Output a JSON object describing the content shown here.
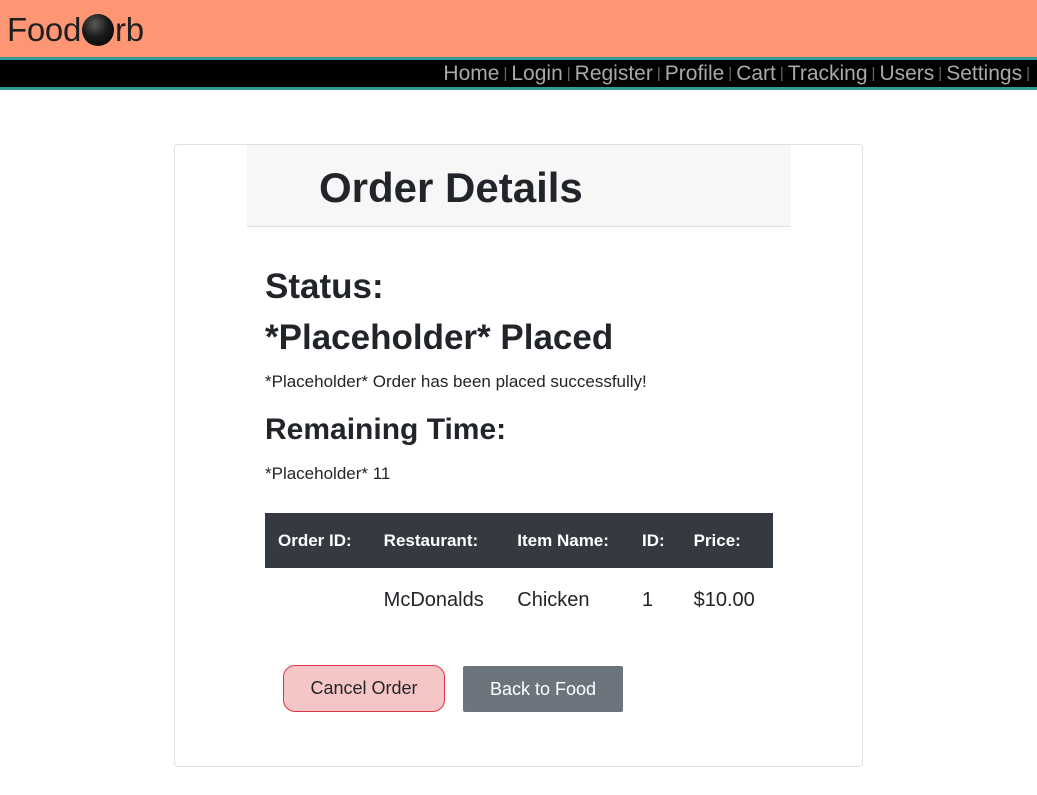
{
  "brand": {
    "prefix": "Food",
    "suffix": "rb"
  },
  "nav": {
    "items": [
      "Home",
      "Login",
      "Register",
      "Profile",
      "Cart",
      "Tracking",
      "Users",
      "Settings"
    ],
    "separator": "|"
  },
  "page": {
    "title": "Order Details",
    "status_label": "Status:",
    "status_value": "*Placeholder* Placed",
    "status_message": "*Placeholder* Order has been placed successfully!",
    "remaining_label": "Remaining Time:",
    "remaining_value": "*Placeholder* 11"
  },
  "table": {
    "headers": [
      "Order ID:",
      "Restaurant:",
      "Item Name:",
      "ID:",
      "Price:"
    ],
    "rows": [
      [
        "",
        "McDonalds",
        "Chicken",
        "1",
        "$10.00"
      ]
    ]
  },
  "buttons": {
    "cancel": "Cancel Order",
    "back": "Back to Food"
  },
  "colors": {
    "brand_bar": "#ff9673",
    "nav_bg": "#000000",
    "accent_teal": "#2f9c95",
    "table_header": "#343a40",
    "cancel_bg": "#f6c6c6",
    "cancel_border": "#dc3545",
    "back_bg": "#6c757d"
  }
}
